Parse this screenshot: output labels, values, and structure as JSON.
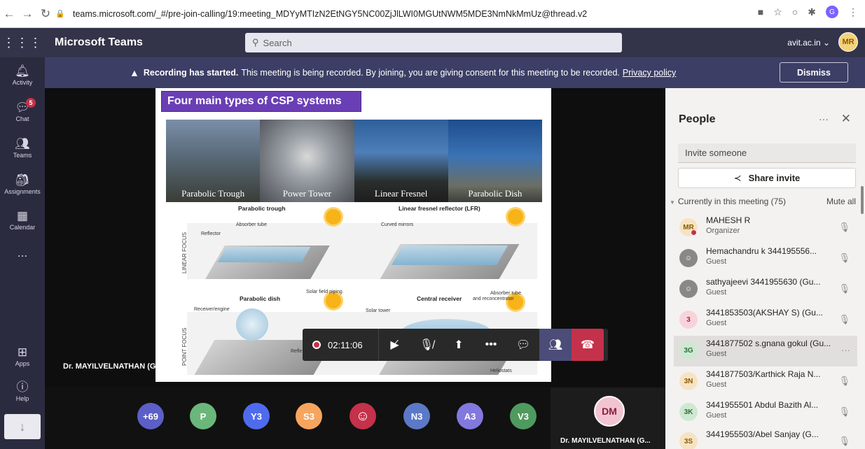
{
  "browser": {
    "url_text": "teams.microsoft.com/_#/pre-join-calling/19:meeting_MDYyMTIzN2EtNGY5NC00ZjJlLWI0MGUtNWM5MDE3NmNkMmUz@thread.v2",
    "profile_initial": "G"
  },
  "header": {
    "app_title": "Microsoft Teams",
    "search_placeholder": "Search",
    "org": "avit.ac.in ⌄",
    "avatar_initials": "MR"
  },
  "rail": {
    "items": [
      {
        "label": "Activity",
        "icon": "bell-icon"
      },
      {
        "label": "Chat",
        "icon": "chat-icon",
        "badge": "5"
      },
      {
        "label": "Teams",
        "icon": "teams-icon"
      },
      {
        "label": "Assignments",
        "icon": "assignments-icon"
      },
      {
        "label": "Calendar",
        "icon": "calendar-icon"
      },
      {
        "label": "Apps",
        "icon": "apps-icon"
      },
      {
        "label": "Help",
        "icon": "help-icon"
      }
    ],
    "more": "..."
  },
  "banner": {
    "bold_text": "Recording has started.",
    "text": "This meeting is being recorded. By joining, you are giving consent for this meeting to be recorded.",
    "link": "Privacy policy",
    "dismiss": "Dismiss"
  },
  "slide": {
    "title": "Four main types of CSP systems",
    "photos": [
      "Parabolic Trough",
      "Power Tower",
      "Linear Fresnel",
      "Parabolic Dish"
    ],
    "quadrants": {
      "tl_title": "Parabolic trough",
      "tr_title": "Linear fresnel reflector (LFR)",
      "bl_title": "Parabolic dish",
      "br_title": "Central receiver"
    },
    "labels": {
      "absorber_tube": "Absorber tube",
      "reflector": "Reflector",
      "solar_field_piping": "Solar field piping",
      "curved_mirrors": "Curved mirrors",
      "absorber_tube_reconcentrator_1": "Absorber tube",
      "absorber_tube_reconcentrator_2": "and reconcentrator",
      "receiver_engine": "Receiver/engine",
      "reflector_cut": "Refle",
      "solar_tower": "Solar tower",
      "heliostats": "Heliostats",
      "linear_focus": "LINEAR FOCUS",
      "point_focus": "POINT FOCUS"
    }
  },
  "speaker_label": "Dr. MAYILVELNATHAN (Guest)",
  "controls": {
    "timer": "02:11:06"
  },
  "gallery": {
    "avatars": [
      {
        "initials": "+69",
        "color": "#5b5fc7"
      },
      {
        "initials": "P",
        "color": "#6bb77b"
      },
      {
        "initials": "Y3",
        "color": "#4f6bed"
      },
      {
        "initials": "S3",
        "color": "#f7a55e"
      },
      {
        "initials": "",
        "color": "#c4314b"
      },
      {
        "initials": "N3",
        "color": "#5b79c7"
      },
      {
        "initials": "A3",
        "color": "#8378de"
      },
      {
        "initials": "V3",
        "color": "#4f9a5f"
      }
    ],
    "tile_initials": "DM",
    "tile_name": "Dr. MAYILVELNATHAN (G..."
  },
  "people": {
    "title": "People",
    "invite_placeholder": "Invite someone",
    "share_invite": "Share invite",
    "section": "Currently in this meeting (75)",
    "mute_all": "Mute all",
    "members": [
      {
        "initials": "MR",
        "name": "MAHESH R",
        "role": "Organizer",
        "bg": "#f7e3c3",
        "fg": "#8a5b00"
      },
      {
        "initials": "",
        "name": "Hemachandru k 344195556...",
        "role": "Guest",
        "bg": "#8a8886",
        "fg": "#fff"
      },
      {
        "initials": "",
        "name": "sathyajeevi 3441955630 (Gu...",
        "role": "Guest",
        "bg": "#8a8886",
        "fg": "#fff"
      },
      {
        "initials": "3",
        "name": "3441853503(AKSHAY S) (Gu...",
        "role": "Guest",
        "bg": "#f8d3dc",
        "fg": "#a4262c"
      },
      {
        "initials": "3G",
        "name": "3441877502 s.gnana gokul (Gu...",
        "role": "Guest",
        "bg": "#cfe8d2",
        "fg": "#2e6b3a"
      },
      {
        "initials": "3N",
        "name": "3441877503/Karthick Raja N...",
        "role": "Guest",
        "bg": "#f7e3c3",
        "fg": "#8a5b00"
      },
      {
        "initials": "3K",
        "name": "3441955501 Abdul Bazith Al...",
        "role": "Guest",
        "bg": "#cfe8d2",
        "fg": "#2e6b3a"
      },
      {
        "initials": "3S",
        "name": "3441955503/Abel Sanjay (G...",
        "role": "",
        "bg": "#f7e3c3",
        "fg": "#8a5b00"
      }
    ]
  }
}
